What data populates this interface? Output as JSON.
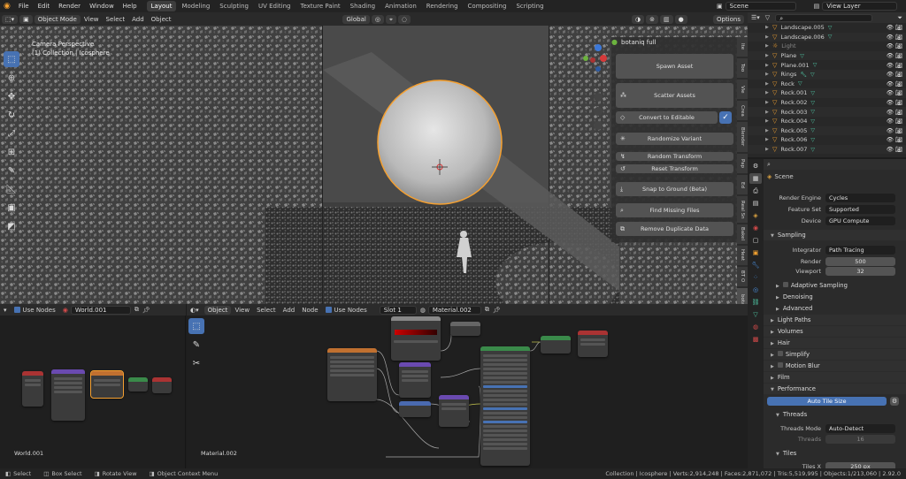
{
  "topbar": {
    "menus": [
      "File",
      "Edit",
      "Render",
      "Window",
      "Help"
    ],
    "tabs": [
      "Layout",
      "Modeling",
      "Sculpting",
      "UV Editing",
      "Texture Paint",
      "Shading",
      "Animation",
      "Rendering",
      "Compositing",
      "Scripting"
    ],
    "active_tab": "Layout",
    "scene": "Scene",
    "view_layer": "View Layer"
  },
  "viewport": {
    "header": {
      "mode": "Object Mode",
      "menus": [
        "View",
        "Select",
        "Add",
        "Object"
      ],
      "orientation": "Global",
      "options": "Options"
    },
    "label_line1": "Camera Perspective",
    "label_line2": "(1) Collection | Icosphere"
  },
  "botaniq": {
    "title": "botaniq full",
    "buttons": [
      {
        "label": "Spawn Asset",
        "icon": "spawn-icon"
      },
      {
        "label": "Scatter Assets",
        "icon": "scatter-icon"
      },
      {
        "label": "Convert to Editable",
        "icon": "convert-icon"
      },
      {
        "label": "Randomize Variant",
        "icon": "randomize-icon"
      },
      {
        "label": "Random Transform",
        "icon": "transform-icon"
      },
      {
        "label": "Reset Transform",
        "icon": "reset-icon"
      },
      {
        "label": "Snap to Ground (Beta)",
        "icon": "snap-icon"
      },
      {
        "label": "Find Missing Files",
        "icon": "find-icon"
      },
      {
        "label": "Remove Duplicate Data",
        "icon": "duplicate-icon"
      }
    ],
    "side_tabs": [
      "Ite",
      "Too",
      "Vie",
      "Crea",
      "Blender",
      "Pap",
      "Ed",
      "Real Sn",
      "Bakel",
      "Heat",
      "BT O",
      "botaniq"
    ]
  },
  "outliner": {
    "items": [
      "Landscape.005",
      "Landscape.006",
      "Light",
      "Plane",
      "Plane.001",
      "Rings",
      "Rock",
      "Rock.001",
      "Rock.002",
      "Rock.003",
      "Rock.004",
      "Rock.005",
      "Rock.006",
      "Rock.007"
    ]
  },
  "properties": {
    "scene_name": "Scene",
    "render_engine_label": "Render Engine",
    "render_engine": "Cycles",
    "feature_set_label": "Feature Set",
    "feature_set": "Supported",
    "device_label": "Device",
    "device": "GPU Compute",
    "sampling": "Sampling",
    "integrator_label": "Integrator",
    "integrator": "Path Tracing",
    "render_label": "Render",
    "render_samples": "500",
    "viewport_label": "Viewport",
    "viewport_samples": "32",
    "adaptive": "Adaptive Sampling",
    "denoising": "Denoising",
    "advanced": "Advanced",
    "light_paths": "Light Paths",
    "volumes": "Volumes",
    "hair": "Hair",
    "simplify": "Simplify",
    "motion_blur": "Motion Blur",
    "film": "Film",
    "performance": "Performance",
    "auto_tile": "Auto Tile Size",
    "threads": "Threads",
    "threads_mode_label": "Threads Mode",
    "threads_mode": "Auto-Detect",
    "threads_count_label": "Threads",
    "threads_count": "16",
    "tiles": "Tiles",
    "tiles_x_label": "Tiles X",
    "tiles_x": "250 px"
  },
  "node_world": {
    "use_nodes": "Use Nodes",
    "world_name": "World.001",
    "footer": "World.001"
  },
  "node_material": {
    "object": "Object",
    "menus": [
      "View",
      "Select",
      "Add",
      "Node"
    ],
    "use_nodes": "Use Nodes",
    "slot": "Slot 1",
    "material": "Material.002",
    "footer": "Material.002"
  },
  "statusbar": {
    "select": "Select",
    "box_select": "Box Select",
    "rotate": "Rotate View",
    "context": "Object Context Menu",
    "stats": "Collection | Icosphere | Verts:2,914,248 | Faces:2,871,072 | Tris:5,519,995 | Objects:1/213,060 | 2.92.0"
  },
  "colors": {
    "accent": "#4772b3",
    "selection_outline": "#f5a030",
    "object_icon": "#f0a030",
    "modifier_icon": "#4fc6a4"
  }
}
